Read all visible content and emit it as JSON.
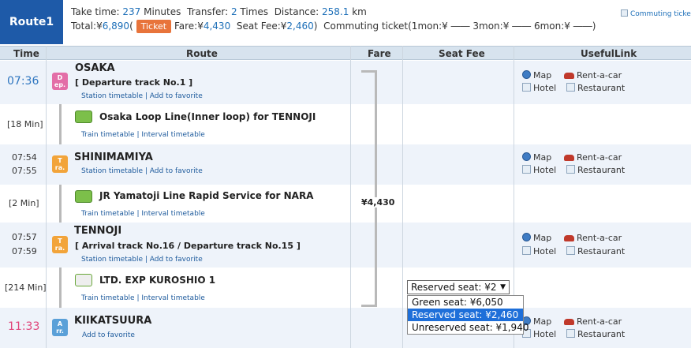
{
  "route_label": "Route1",
  "summary": {
    "take_time_label": "Take time:",
    "take_time_value": "237",
    "minutes_label": "Minutes",
    "transfer_label": "Transfer:",
    "transfer_value": "2",
    "times_label": "Times",
    "distance_label": "Distance:",
    "distance_value": "258.1",
    "km_label": "km",
    "total_label": "Total:¥",
    "total_value": "6,890",
    "paren_open": "(",
    "ticket_button": "Ticket",
    "fare_label": "Fare:¥",
    "fare_value": "4,430",
    "seat_fee_label": "Seat Fee:¥",
    "seat_fee_value": "2,460",
    "paren_close": ")",
    "commuting_text": "Commuting ticket(1mon:¥ ―― 3mon:¥ ―― 6mon:¥ ――)",
    "commuting_link": "Commuting ticket"
  },
  "headers": {
    "time": "Time",
    "route": "Route",
    "fare": "Fare",
    "seat_fee": "Seat Fee",
    "useful": "UsefulLink"
  },
  "useful_links": {
    "map": "Map",
    "rent": "Rent-a-car",
    "hotel": "Hotel",
    "restaurant": "Restaurant"
  },
  "stations": [
    {
      "time1": "07:36",
      "time2": "",
      "badge": [
        "D",
        "ep."
      ],
      "name": "OSAKA",
      "track": "[ Departure track No.1 ]",
      "link1": "Station timetable",
      "link2": "Add to favorite"
    },
    {
      "time1": "07:54",
      "time2": "07:55",
      "badge": [
        "T",
        "ra."
      ],
      "name": "SHINIMAMIYA",
      "track": "",
      "link1": "Station timetable",
      "link2": "Add to favorite"
    },
    {
      "time1": "07:57",
      "time2": "07:59",
      "badge": [
        "T",
        "ra."
      ],
      "name": "TENNOJI",
      "track": "[ Arrival track No.16 / Departure track No.15 ]",
      "link1": "Station timetable",
      "link2": "Add to favorite"
    },
    {
      "time1": "11:33",
      "time2": "",
      "badge": [
        "A",
        "rr."
      ],
      "name": "KIIKATSUURA",
      "track": "",
      "link1": "",
      "link2": "Add to favorite"
    }
  ],
  "segments": [
    {
      "duration": "[18 Min]",
      "line": "Osaka Loop Line(Inner loop)  for TENNOJI",
      "link1": "Train timetable",
      "link2": "Interval timetable"
    },
    {
      "duration": "[2 Min]",
      "line": "JR Yamatoji Line Rapid Service  for NARA",
      "link1": "Train timetable",
      "link2": "Interval timetable"
    },
    {
      "duration": "[214 Min]",
      "line": "LTD. EXP KUROSHIO 1",
      "link1": "Train timetable",
      "link2": "Interval timetable"
    }
  ],
  "fare_amount": "¥4,430",
  "seat_select": {
    "selected": "Reserved seat: ¥2",
    "options": [
      "Green seat: ¥6,050",
      "Reserved seat: ¥2,460",
      "Unreserved seat: ¥1,940"
    ],
    "highlighted_index": 1
  },
  "colors": {
    "accent": "#2f76c0",
    "arrival_time": "#e0457b",
    "ticket": "#e8743b",
    "header_bg": "#d7e3ee"
  }
}
